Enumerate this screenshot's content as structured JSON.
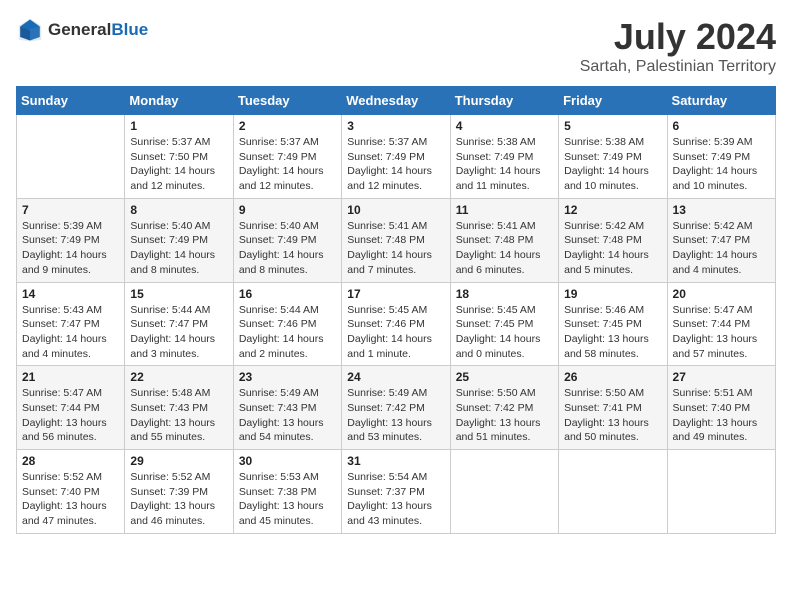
{
  "header": {
    "logo_line1": "General",
    "logo_line2": "Blue",
    "title": "July 2024",
    "subtitle": "Sartah, Palestinian Territory"
  },
  "days_of_week": [
    "Sunday",
    "Monday",
    "Tuesday",
    "Wednesday",
    "Thursday",
    "Friday",
    "Saturday"
  ],
  "weeks": [
    [
      {
        "day": "",
        "info": ""
      },
      {
        "day": "1",
        "info": "Sunrise: 5:37 AM\nSunset: 7:50 PM\nDaylight: 14 hours\nand 12 minutes."
      },
      {
        "day": "2",
        "info": "Sunrise: 5:37 AM\nSunset: 7:49 PM\nDaylight: 14 hours\nand 12 minutes."
      },
      {
        "day": "3",
        "info": "Sunrise: 5:37 AM\nSunset: 7:49 PM\nDaylight: 14 hours\nand 12 minutes."
      },
      {
        "day": "4",
        "info": "Sunrise: 5:38 AM\nSunset: 7:49 PM\nDaylight: 14 hours\nand 11 minutes."
      },
      {
        "day": "5",
        "info": "Sunrise: 5:38 AM\nSunset: 7:49 PM\nDaylight: 14 hours\nand 10 minutes."
      },
      {
        "day": "6",
        "info": "Sunrise: 5:39 AM\nSunset: 7:49 PM\nDaylight: 14 hours\nand 10 minutes."
      }
    ],
    [
      {
        "day": "7",
        "info": "Sunrise: 5:39 AM\nSunset: 7:49 PM\nDaylight: 14 hours\nand 9 minutes."
      },
      {
        "day": "8",
        "info": "Sunrise: 5:40 AM\nSunset: 7:49 PM\nDaylight: 14 hours\nand 8 minutes."
      },
      {
        "day": "9",
        "info": "Sunrise: 5:40 AM\nSunset: 7:49 PM\nDaylight: 14 hours\nand 8 minutes."
      },
      {
        "day": "10",
        "info": "Sunrise: 5:41 AM\nSunset: 7:48 PM\nDaylight: 14 hours\nand 7 minutes."
      },
      {
        "day": "11",
        "info": "Sunrise: 5:41 AM\nSunset: 7:48 PM\nDaylight: 14 hours\nand 6 minutes."
      },
      {
        "day": "12",
        "info": "Sunrise: 5:42 AM\nSunset: 7:48 PM\nDaylight: 14 hours\nand 5 minutes."
      },
      {
        "day": "13",
        "info": "Sunrise: 5:42 AM\nSunset: 7:47 PM\nDaylight: 14 hours\nand 4 minutes."
      }
    ],
    [
      {
        "day": "14",
        "info": "Sunrise: 5:43 AM\nSunset: 7:47 PM\nDaylight: 14 hours\nand 4 minutes."
      },
      {
        "day": "15",
        "info": "Sunrise: 5:44 AM\nSunset: 7:47 PM\nDaylight: 14 hours\nand 3 minutes."
      },
      {
        "day": "16",
        "info": "Sunrise: 5:44 AM\nSunset: 7:46 PM\nDaylight: 14 hours\nand 2 minutes."
      },
      {
        "day": "17",
        "info": "Sunrise: 5:45 AM\nSunset: 7:46 PM\nDaylight: 14 hours\nand 1 minute."
      },
      {
        "day": "18",
        "info": "Sunrise: 5:45 AM\nSunset: 7:45 PM\nDaylight: 14 hours\nand 0 minutes."
      },
      {
        "day": "19",
        "info": "Sunrise: 5:46 AM\nSunset: 7:45 PM\nDaylight: 13 hours\nand 58 minutes."
      },
      {
        "day": "20",
        "info": "Sunrise: 5:47 AM\nSunset: 7:44 PM\nDaylight: 13 hours\nand 57 minutes."
      }
    ],
    [
      {
        "day": "21",
        "info": "Sunrise: 5:47 AM\nSunset: 7:44 PM\nDaylight: 13 hours\nand 56 minutes."
      },
      {
        "day": "22",
        "info": "Sunrise: 5:48 AM\nSunset: 7:43 PM\nDaylight: 13 hours\nand 55 minutes."
      },
      {
        "day": "23",
        "info": "Sunrise: 5:49 AM\nSunset: 7:43 PM\nDaylight: 13 hours\nand 54 minutes."
      },
      {
        "day": "24",
        "info": "Sunrise: 5:49 AM\nSunset: 7:42 PM\nDaylight: 13 hours\nand 53 minutes."
      },
      {
        "day": "25",
        "info": "Sunrise: 5:50 AM\nSunset: 7:42 PM\nDaylight: 13 hours\nand 51 minutes."
      },
      {
        "day": "26",
        "info": "Sunrise: 5:50 AM\nSunset: 7:41 PM\nDaylight: 13 hours\nand 50 minutes."
      },
      {
        "day": "27",
        "info": "Sunrise: 5:51 AM\nSunset: 7:40 PM\nDaylight: 13 hours\nand 49 minutes."
      }
    ],
    [
      {
        "day": "28",
        "info": "Sunrise: 5:52 AM\nSunset: 7:40 PM\nDaylight: 13 hours\nand 47 minutes."
      },
      {
        "day": "29",
        "info": "Sunrise: 5:52 AM\nSunset: 7:39 PM\nDaylight: 13 hours\nand 46 minutes."
      },
      {
        "day": "30",
        "info": "Sunrise: 5:53 AM\nSunset: 7:38 PM\nDaylight: 13 hours\nand 45 minutes."
      },
      {
        "day": "31",
        "info": "Sunrise: 5:54 AM\nSunset: 7:37 PM\nDaylight: 13 hours\nand 43 minutes."
      },
      {
        "day": "",
        "info": ""
      },
      {
        "day": "",
        "info": ""
      },
      {
        "day": "",
        "info": ""
      }
    ]
  ]
}
